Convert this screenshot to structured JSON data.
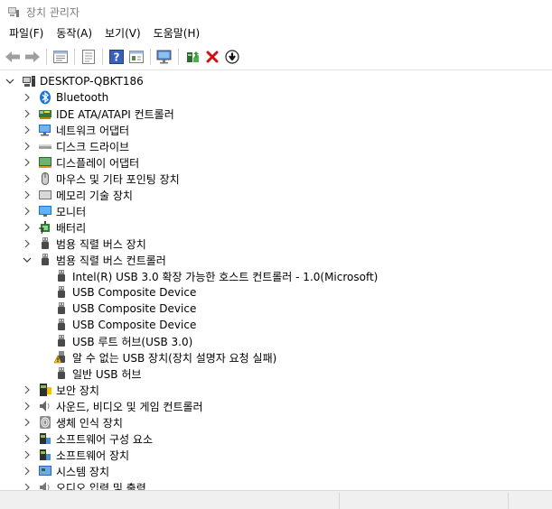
{
  "window": {
    "title": "장치 관리자"
  },
  "menu": [
    {
      "label": "파일(F)"
    },
    {
      "label": "동작(A)"
    },
    {
      "label": "보기(V)"
    },
    {
      "label": "도움말(H)"
    }
  ],
  "toolbar": [
    {
      "name": "back-icon"
    },
    {
      "name": "forward-icon"
    },
    {
      "sep": true
    },
    {
      "name": "properties-icon"
    },
    {
      "sep": true
    },
    {
      "name": "show-hidden-icon"
    },
    {
      "sep": true
    },
    {
      "name": "help-icon"
    },
    {
      "name": "action-view-icon"
    },
    {
      "sep": true
    },
    {
      "name": "scan-hardware-icon"
    },
    {
      "sep": true
    },
    {
      "name": "update-driver-icon"
    },
    {
      "name": "uninstall-icon"
    },
    {
      "name": "disable-device-icon"
    }
  ],
  "tree": [
    {
      "level": 0,
      "expander": "open",
      "icon": "computer-icon",
      "label": "DESKTOP-QBKT186"
    },
    {
      "level": 1,
      "expander": "closed",
      "icon": "bluetooth-icon",
      "label": "Bluetooth"
    },
    {
      "level": 1,
      "expander": "closed",
      "icon": "ide-controller-icon",
      "label": "IDE ATA/ATAPI 컨트롤러"
    },
    {
      "level": 1,
      "expander": "closed",
      "icon": "network-adapter-icon",
      "label": "네트워크 어댑터"
    },
    {
      "level": 1,
      "expander": "closed",
      "icon": "disk-drive-icon",
      "label": "디스크 드라이브"
    },
    {
      "level": 1,
      "expander": "closed",
      "icon": "display-adapter-icon",
      "label": "디스플레이 어댑터"
    },
    {
      "level": 1,
      "expander": "closed",
      "icon": "mouse-icon",
      "label": "마우스 및 기타 포인팅 장치"
    },
    {
      "level": 1,
      "expander": "closed",
      "icon": "memory-icon",
      "label": "메모리 기술 장치"
    },
    {
      "level": 1,
      "expander": "closed",
      "icon": "monitor-icon",
      "label": "모니터"
    },
    {
      "level": 1,
      "expander": "closed",
      "icon": "battery-icon",
      "label": "배터리"
    },
    {
      "level": 1,
      "expander": "closed",
      "icon": "usb-icon",
      "label": "범용 직렬 버스 장치"
    },
    {
      "level": 1,
      "expander": "open",
      "icon": "usb-icon",
      "label": "범용 직렬 버스 컨트롤러"
    },
    {
      "level": 2,
      "expander": "none",
      "icon": "usb-icon",
      "label": "Intel(R) USB 3.0 확장 가능한 호스트 컨트롤러 - 1.0(Microsoft)"
    },
    {
      "level": 2,
      "expander": "none",
      "icon": "usb-icon",
      "label": "USB Composite Device"
    },
    {
      "level": 2,
      "expander": "none",
      "icon": "usb-icon",
      "label": "USB Composite Device"
    },
    {
      "level": 2,
      "expander": "none",
      "icon": "usb-icon",
      "label": "USB Composite Device"
    },
    {
      "level": 2,
      "expander": "none",
      "icon": "usb-icon",
      "label": "USB 루트 허브(USB 3.0)"
    },
    {
      "level": 2,
      "expander": "none",
      "icon": "warning-icon",
      "label": "알 수 없는 USB 장치(장치 설명자 요청 실패)"
    },
    {
      "level": 2,
      "expander": "none",
      "icon": "usb-icon",
      "label": "일반 USB 허브"
    },
    {
      "level": 1,
      "expander": "closed",
      "icon": "security-device-icon",
      "label": "보안 장치"
    },
    {
      "level": 1,
      "expander": "closed",
      "icon": "sound-icon",
      "label": "사운드, 비디오 및 게임 컨트롤러"
    },
    {
      "level": 1,
      "expander": "closed",
      "icon": "biometric-icon",
      "label": "생체 인식 장치"
    },
    {
      "level": 1,
      "expander": "closed",
      "icon": "software-component-icon",
      "label": "소프트웨어 구성 요소"
    },
    {
      "level": 1,
      "expander": "closed",
      "icon": "software-device-icon",
      "label": "소프트웨어 장치"
    },
    {
      "level": 1,
      "expander": "closed",
      "icon": "system-device-icon",
      "label": "시스템 장치"
    },
    {
      "level": 1,
      "expander": "closed",
      "icon": "audio-io-icon",
      "label": "오디오 입력 및 출력"
    }
  ]
}
